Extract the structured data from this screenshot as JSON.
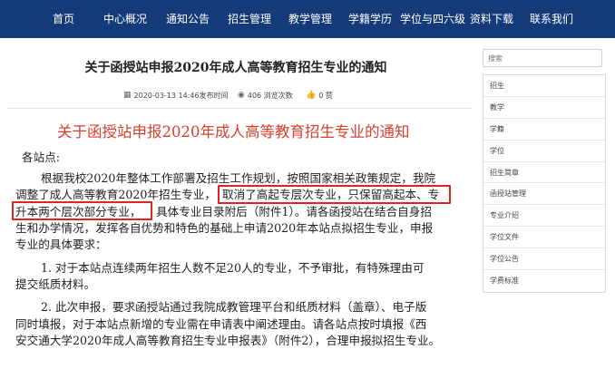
{
  "nav": {
    "items": [
      "首页",
      "中心概况",
      "通知公告",
      "招生管理",
      "教学管理",
      "学籍学历",
      "学位与四六级",
      "资料下载",
      "联系我们"
    ]
  },
  "article": {
    "title": "关于函授站申报2020年成人高等教育招生专业的通知",
    "meta": {
      "datetime": "2020-03-13 14:46发布时间",
      "views": "406 浏览次数",
      "likes": "0 赞"
    }
  },
  "document": {
    "heading": "关于函授站申报2020年成人高等教育招生专业的通知",
    "salutation": "各站点:",
    "lines": {
      "l1": "根据我校2020年整体工作部署及招生工作规划，按照国家相关政策规定，我院",
      "l2a": "调整了成人高等教育2020年招生专业，",
      "l2b": "取消了高起专层次专业，只保留高起本、专",
      "l3a": "升本两个层次部分专业，",
      "l3b": "具体专业目录附后（附件1）。请各函授站在结合自身招",
      "l4": "生和办学情况，发挥各自优势和特色的基础上申请2020年本站点拟招生专业，申报",
      "l5": "专业的具体要求：",
      "l6": "1. 对于本站点连续两年招生人数不足20人的专业，不予审批，有特殊理由可",
      "l7": "提交纸质材料。",
      "l8": "2. 此次申报，要求函授站通过我院成教管理平台和纸质材料（盖章）、电子版",
      "l9": "同时填报，对于本站点新增的专业需在申请表中阐述理由。请各站点按时填报《西",
      "l10": "安交通大学2020年成人高等教育招生专业申报表》（附件2），合理申报拟招生专业。"
    }
  },
  "sidebar": {
    "search_placeholder": "搜索",
    "items": [
      "招生",
      "教学",
      "学籍",
      "学位",
      "招生简章",
      "函授站管理",
      "专业介绍",
      "学位文件",
      "学位公告",
      "学费标准"
    ]
  },
  "icons": {
    "calendar": "calendar-icon",
    "eye": "eye-icon",
    "thumb": "thumbs-up-icon"
  },
  "colors": {
    "nav_bg": "#143a7a",
    "heading_red": "#d9402b",
    "highlight_red": "#e02424"
  }
}
